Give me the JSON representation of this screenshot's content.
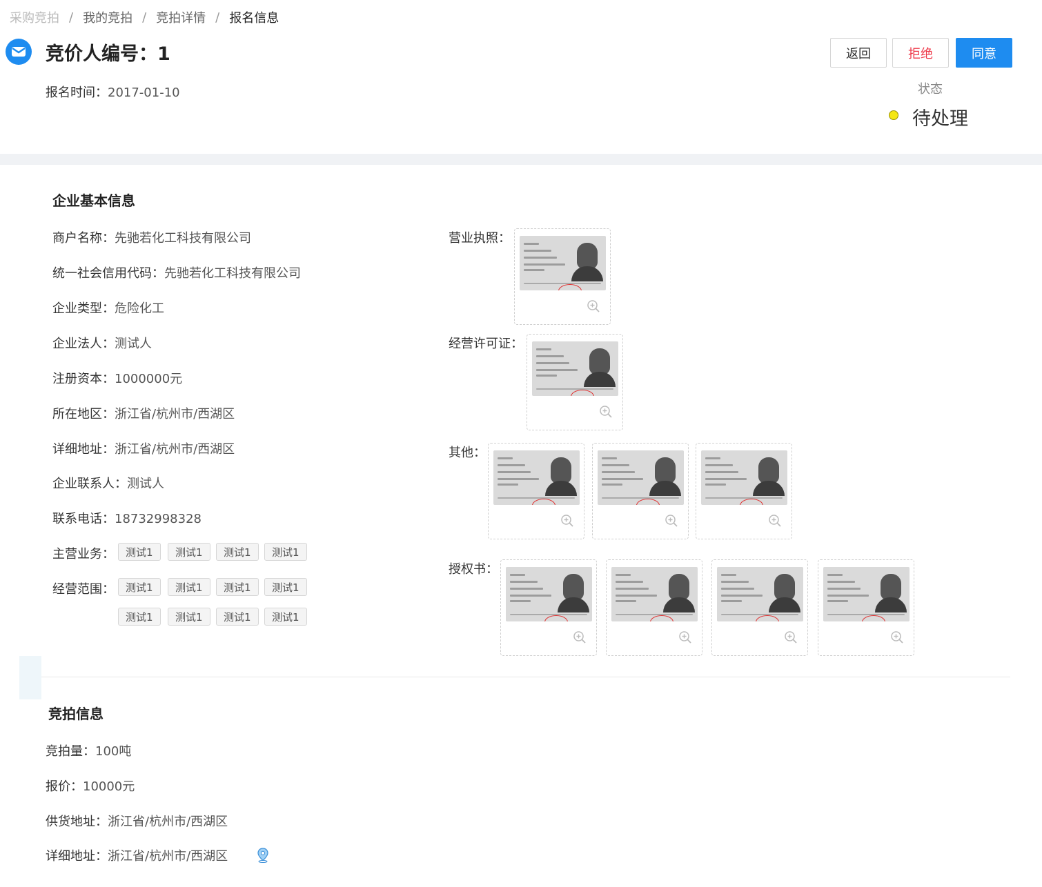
{
  "breadcrumb": [
    "采购竞拍",
    "我的竞拍",
    "竞拍详情",
    "报名信息"
  ],
  "breadcrumb_sep": "/",
  "header": {
    "title": "竞价人编号：1",
    "signup_time_label": "报名时间：",
    "signup_time": "2017-01-10"
  },
  "actions": {
    "back": "返回",
    "reject": "拒绝",
    "agree": "同意"
  },
  "status": {
    "label": "状态",
    "value": "待处理",
    "dot_color": "#f5e712"
  },
  "colors": {
    "primary": "#1e8cf0",
    "danger": "#ee3a4a",
    "page_band": "#f0f2f5"
  },
  "company": {
    "section_title": "企业基本信息",
    "fields": [
      {
        "label": "商户名称：",
        "value": "先驰若化工科技有限公司"
      },
      {
        "label": "统一社会信用代码：",
        "value": "先驰若化工科技有限公司"
      },
      {
        "label": "企业类型：",
        "value": "危险化工"
      },
      {
        "label": "企业法人：",
        "value": "测试人"
      },
      {
        "label": "注册资本：",
        "value": "1000000元"
      },
      {
        "label": "所在地区：",
        "value": "浙江省/杭州市/西湖区"
      },
      {
        "label": "详细地址：",
        "value": "浙江省/杭州市/西湖区"
      },
      {
        "label": "企业联系人：",
        "value": "测试人"
      },
      {
        "label": "联系电话：",
        "value": "18732998328"
      }
    ],
    "main_business_label": "主营业务：",
    "main_business": [
      "测试1",
      "测试1",
      "测试1",
      "测试1"
    ],
    "scope_label": "经营范围：",
    "scope": [
      "测试1",
      "测试1",
      "测试1",
      "测试1",
      "测试1",
      "测试1",
      "测试1",
      "测试1"
    ],
    "images": [
      {
        "label": "营业执照：",
        "count": 1
      },
      {
        "label": "经营许可证：",
        "count": 1
      },
      {
        "label": "其他：",
        "count": 3
      },
      {
        "label": "授权书：",
        "count": 4
      }
    ]
  },
  "auction": {
    "section_title": "竞拍信息",
    "fields": [
      {
        "label": "竞拍量：",
        "value": "100吨"
      },
      {
        "label": "报价：",
        "value": "10000元"
      },
      {
        "label": "供货地址：",
        "value": "浙江省/杭州市/西湖区"
      },
      {
        "label": "详细地址：",
        "value": "浙江省/杭州市/西湖区"
      }
    ]
  }
}
